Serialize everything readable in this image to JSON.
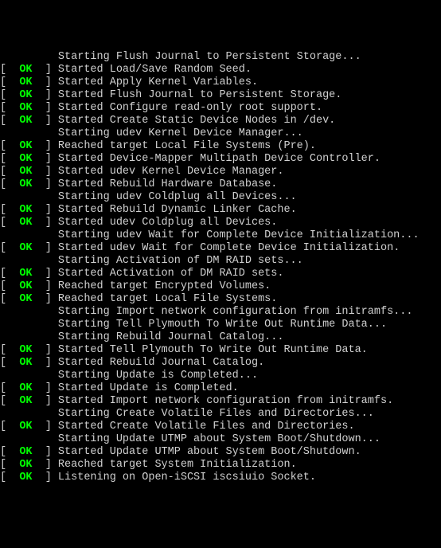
{
  "lines": [
    {
      "status": "",
      "text": "         Starting Flush Journal to Persistent Storage..."
    },
    {
      "status": "OK",
      "text": "Started Load/Save Random Seed."
    },
    {
      "status": "OK",
      "text": "Started Apply Kernel Variables."
    },
    {
      "status": "OK",
      "text": "Started Flush Journal to Persistent Storage."
    },
    {
      "status": "OK",
      "text": "Started Configure read-only root support."
    },
    {
      "status": "OK",
      "text": "Started Create Static Device Nodes in /dev."
    },
    {
      "status": "",
      "text": "         Starting udev Kernel Device Manager..."
    },
    {
      "status": "OK",
      "text": "Reached target Local File Systems (Pre)."
    },
    {
      "status": "OK",
      "text": "Started Device-Mapper Multipath Device Controller."
    },
    {
      "status": "OK",
      "text": "Started udev Kernel Device Manager."
    },
    {
      "status": "OK",
      "text": "Started Rebuild Hardware Database."
    },
    {
      "status": "",
      "text": "         Starting udev Coldplug all Devices..."
    },
    {
      "status": "OK",
      "text": "Started Rebuild Dynamic Linker Cache."
    },
    {
      "status": "OK",
      "text": "Started udev Coldplug all Devices."
    },
    {
      "status": "",
      "text": "         Starting udev Wait for Complete Device Initialization..."
    },
    {
      "status": "OK",
      "text": "Started udev Wait for Complete Device Initialization."
    },
    {
      "status": "",
      "text": "         Starting Activation of DM RAID sets..."
    },
    {
      "status": "OK",
      "text": "Started Activation of DM RAID sets."
    },
    {
      "status": "OK",
      "text": "Reached target Encrypted Volumes."
    },
    {
      "status": "OK",
      "text": "Reached target Local File Systems."
    },
    {
      "status": "",
      "text": "         Starting Import network configuration from initramfs..."
    },
    {
      "status": "",
      "text": "         Starting Tell Plymouth To Write Out Runtime Data..."
    },
    {
      "status": "",
      "text": "         Starting Rebuild Journal Catalog..."
    },
    {
      "status": "OK",
      "text": "Started Tell Plymouth To Write Out Runtime Data."
    },
    {
      "status": "OK",
      "text": "Started Rebuild Journal Catalog."
    },
    {
      "status": "",
      "text": "         Starting Update is Completed..."
    },
    {
      "status": "OK",
      "text": "Started Update is Completed."
    },
    {
      "status": "OK",
      "text": "Started Import network configuration from initramfs."
    },
    {
      "status": "",
      "text": "         Starting Create Volatile Files and Directories..."
    },
    {
      "status": "OK",
      "text": "Started Create Volatile Files and Directories."
    },
    {
      "status": "",
      "text": "         Starting Update UTMP about System Boot/Shutdown..."
    },
    {
      "status": "OK",
      "text": "Started Update UTMP about System Boot/Shutdown."
    },
    {
      "status": "OK",
      "text": "Reached target System Initialization."
    },
    {
      "status": "OK",
      "text": "Listening on Open-iSCSI iscsiuio Socket."
    }
  ]
}
